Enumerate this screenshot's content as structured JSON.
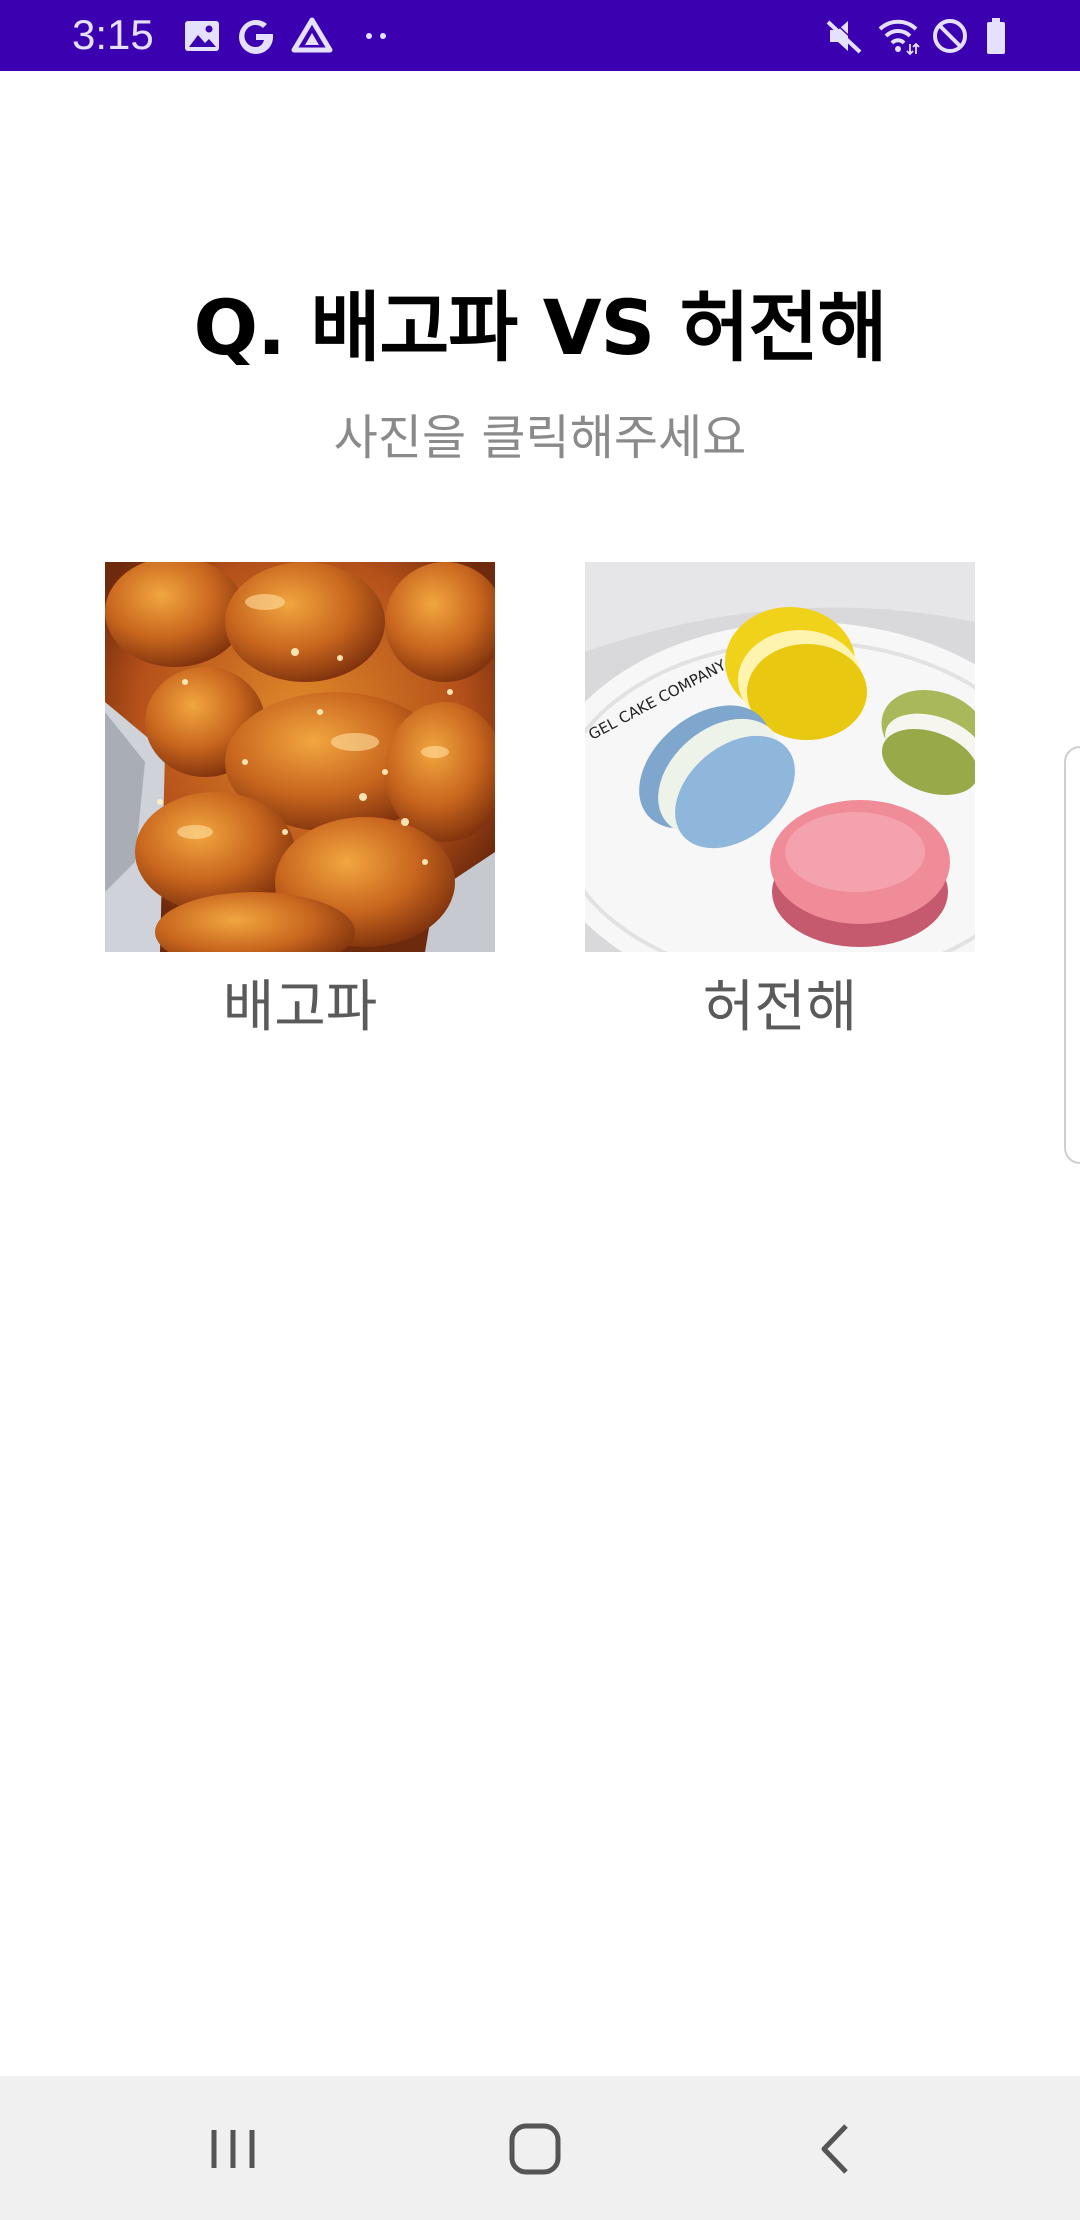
{
  "status_bar": {
    "time": "3:15",
    "left_icons": [
      "gallery-icon",
      "google-icon",
      "drive-icon",
      "more-dots-icon"
    ],
    "right_icons": [
      "mute-icon",
      "wifi-icon",
      "do-not-disturb-icon",
      "battery-icon"
    ],
    "color": "#3b00b0"
  },
  "question": {
    "title": "Q. 배고파 VS 허전해",
    "subtitle": "사진을 클릭해주세요"
  },
  "options": [
    {
      "label": "배고파",
      "image": "fried-chicken-photo"
    },
    {
      "label": "허전해",
      "image": "macarons-photo"
    }
  ],
  "macaron_plate_text": "GEL CAKE COMPANY",
  "nav_bar": {
    "buttons": [
      "recent-apps-icon",
      "home-icon",
      "back-icon"
    ]
  }
}
